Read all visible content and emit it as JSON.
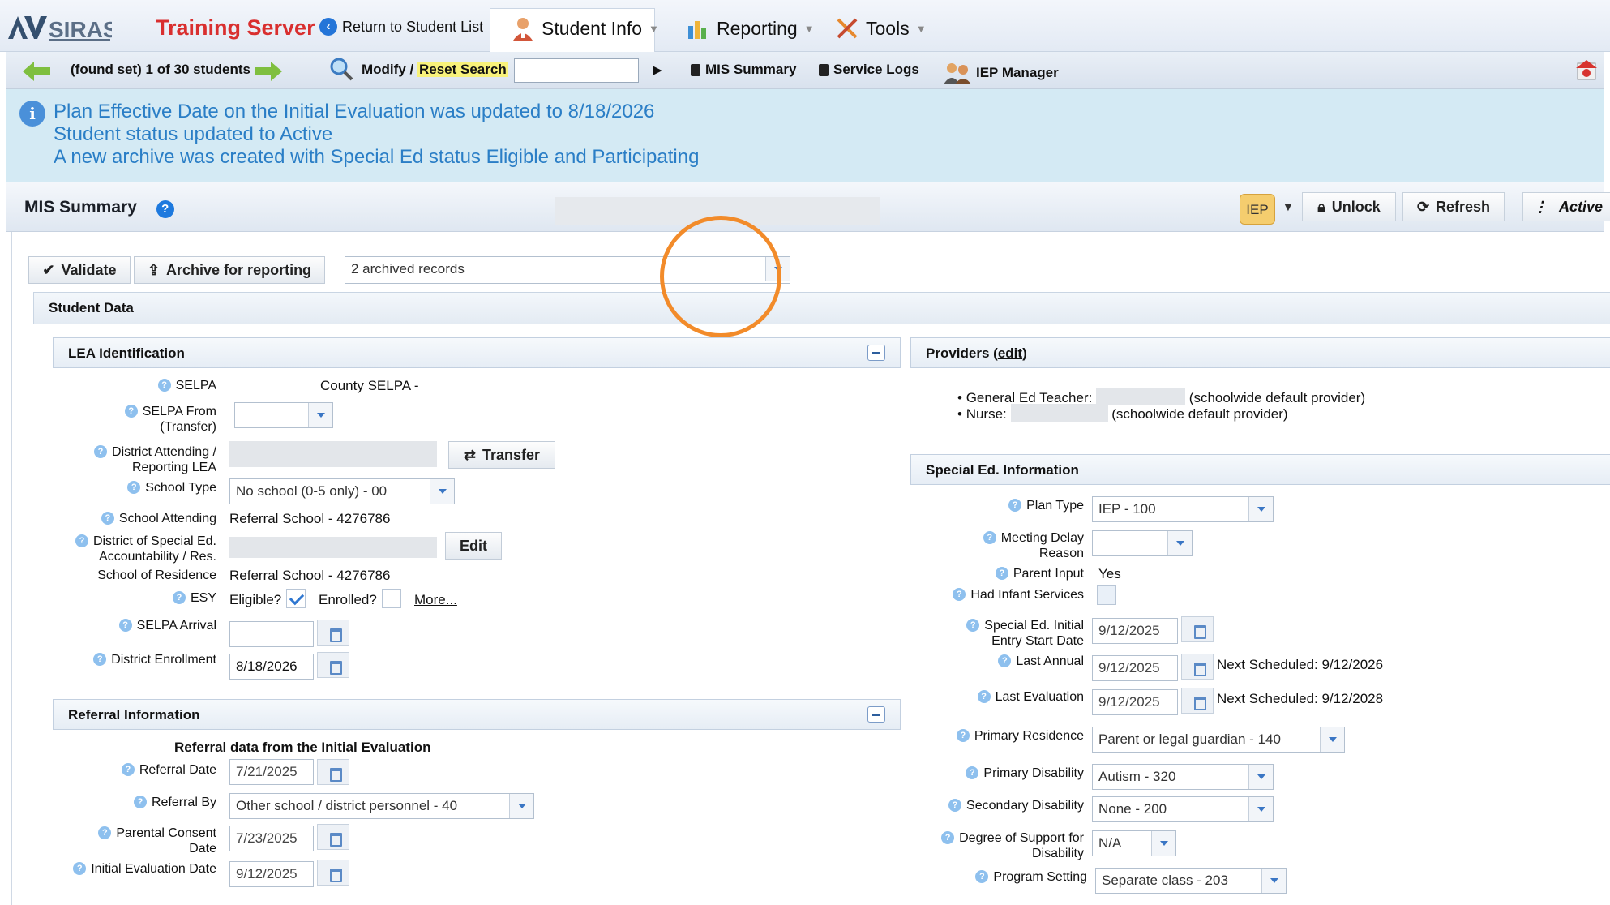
{
  "header": {
    "logo_text": "SIRAS",
    "server_name": "Training Server",
    "return_label": "Return to Student List",
    "menus": [
      "Student Info",
      "Reporting",
      "Tools"
    ]
  },
  "toolbar": {
    "found_set": "(found set) 1 of 30 students",
    "modify": "Modify",
    "separator": "/",
    "reset_search": "Reset Search",
    "search_value": "",
    "mis_summary": "MIS Summary",
    "service_logs": "Service Logs",
    "iep_manager": "IEP Manager"
  },
  "banner": {
    "lines": [
      "Plan Effective Date on the Initial Evaluation was updated to 8/18/2026",
      "Student status updated to Active",
      "A new archive was created with Special Ed status Eligible and Participating"
    ]
  },
  "mis_header": {
    "title": "MIS Summary",
    "iep_badge": "IEP",
    "unlock": "Unlock",
    "refresh": "Refresh",
    "status": "Active"
  },
  "actions": {
    "validate": "Validate",
    "archive": "Archive for reporting",
    "archived_records": "2 archived records"
  },
  "student_data": {
    "title": "Student Data"
  },
  "lea": {
    "title": "LEA Identification",
    "selpa_label": "SELPA",
    "selpa_value": "County SELPA -",
    "selpa_from_label": "SELPA From (Transfer)",
    "district_attending_label": "District Attending / Reporting LEA",
    "transfer_button": "Transfer",
    "school_type_label": "School Type",
    "school_type_value": "No school (0-5 only) - 00",
    "school_attending_label": "School Attending",
    "school_attending_value": "Referral School - 4276786",
    "district_special_ed_label": "District of Special Ed. Accountability / Res.",
    "edit_button": "Edit",
    "school_residence_label": "School of Residence",
    "school_residence_value": "Referral School - 4276786",
    "esy_label": "ESY",
    "eligible_label": "Eligible?",
    "enrolled_label": "Enrolled?",
    "more_link": "More...",
    "selpa_arrival_label": "SELPA Arrival",
    "district_enrollment_label": "District Enrollment",
    "district_enrollment_value": "8/18/2026"
  },
  "referral": {
    "title": "Referral Information",
    "subtitle": "Referral data from the Initial Evaluation",
    "referral_date_label": "Referral Date",
    "referral_date_value": "7/21/2025",
    "referral_by_label": "Referral By",
    "referral_by_value": "Other school / district personnel - 40",
    "parental_consent_label": "Parental Consent Date",
    "parental_consent_value": "7/23/2025",
    "initial_eval_label": "Initial Evaluation Date",
    "initial_eval_value": "9/12/2025"
  },
  "providers": {
    "title": "Providers",
    "edit_link": "edit",
    "general_ed_label": "General Ed Teacher:",
    "general_ed_note": "(schoolwide default provider)",
    "nurse_label": "Nurse:",
    "nurse_note": "(schoolwide default provider)"
  },
  "special_ed": {
    "title": "Special Ed. Information",
    "plan_type_label": "Plan Type",
    "plan_type_value": "IEP - 100",
    "meeting_delay_label": "Meeting Delay Reason",
    "parent_input_label": "Parent Input",
    "parent_input_value": "Yes",
    "infant_services_label": "Had Infant Services",
    "initial_entry_label": "Special Ed. Initial Entry Start Date",
    "initial_entry_value": "9/12/2025",
    "last_annual_label": "Last Annual",
    "last_annual_value": "9/12/2025",
    "next_annual": "Next Scheduled: 9/12/2026",
    "last_eval_label": "Last Evaluation",
    "last_eval_value": "9/12/2025",
    "next_eval": "Next Scheduled: 9/12/2028",
    "primary_residence_label": "Primary Residence",
    "primary_residence_value": "Parent or legal guardian - 140",
    "primary_disability_label": "Primary Disability",
    "primary_disability_value": "Autism - 320",
    "secondary_disability_label": "Secondary Disability",
    "secondary_disability_value": "None - 200",
    "degree_support_label": "Degree of Support for Disability",
    "degree_support_value": "N/A",
    "program_setting_label": "Program Setting",
    "program_setting_value": "Separate class - 203"
  },
  "colors": {
    "server_name": "#d92f2f",
    "banner_text": "#2a7ec6",
    "banner_bg": "#d4eaf4",
    "highlight_ring": "#f28b2a"
  }
}
